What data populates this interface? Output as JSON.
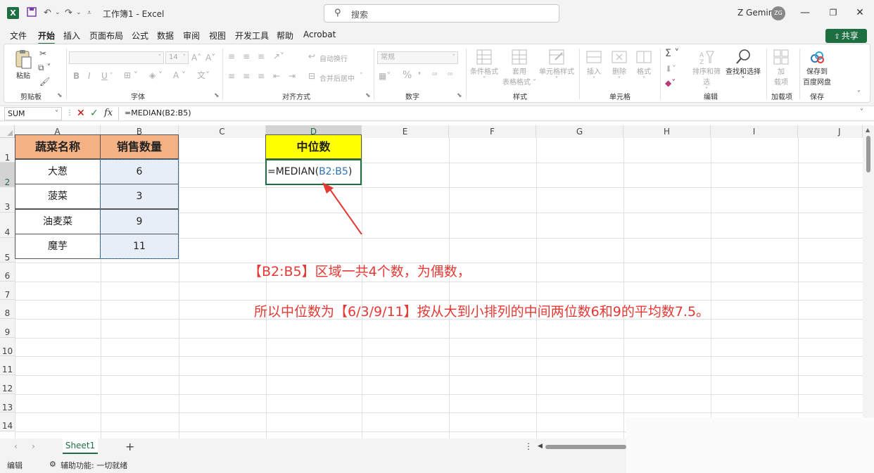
{
  "titlebar": {
    "logo": "X",
    "title": "工作簿1 - Excel",
    "search_placeholder": "搜索",
    "user": "Z Gemini",
    "avatar": "ZG"
  },
  "menu": {
    "tabs": [
      "文件",
      "开始",
      "插入",
      "页面布局",
      "公式",
      "数据",
      "审阅",
      "视图",
      "开发工具",
      "帮助",
      "Acrobat"
    ],
    "active": "开始",
    "share": "共享"
  },
  "ribbon": {
    "clipboard": {
      "paste": "粘贴",
      "label": "剪贴板"
    },
    "font": {
      "size": "14",
      "bold": "B",
      "italic": "I",
      "underline": "U",
      "label": "字体"
    },
    "alignment": {
      "wrap": "自动换行",
      "merge": "合并后居中",
      "label": "对齐方式"
    },
    "number": {
      "format": "常规",
      "label": "数字"
    },
    "styles": {
      "conditional_1": "条件格式",
      "table_1": "套用",
      "table_2": "表格格式",
      "cell_styles": "单元格样式",
      "label": "样式"
    },
    "cells": {
      "insert": "插入",
      "delete": "删除",
      "format": "格式",
      "label": "单元格"
    },
    "editing": {
      "sort": "排序和筛选",
      "find": "查找和选择",
      "label": "编辑"
    },
    "addins": {
      "btn_1": "加",
      "btn_2": "载项",
      "label": "加载项"
    },
    "save": {
      "btn_1": "保存到",
      "btn_2": "百度网盘",
      "label": "保存"
    }
  },
  "formula_bar": {
    "name_box": "SUM",
    "formula": "=MEDIAN(B2:B5)"
  },
  "grid": {
    "columns": [
      "A",
      "B",
      "C",
      "D",
      "E",
      "F",
      "G",
      "H",
      "I",
      "J"
    ],
    "rows": [
      "1",
      "2",
      "3",
      "4",
      "5",
      "6",
      "7",
      "8",
      "9",
      "10",
      "11",
      "12",
      "13",
      "14"
    ],
    "header_a": "蔬菜名称",
    "header_b": "销售数量",
    "table": [
      {
        "name": "大葱",
        "qty": "6"
      },
      {
        "name": "菠菜",
        "qty": "3"
      },
      {
        "name": "油麦菜",
        "qty": "9"
      },
      {
        "name": "魔芋",
        "qty": "11"
      }
    ],
    "d1": "中位数",
    "d2_prefix": "=MEDIAN(",
    "d2_ref": "B2:B5",
    "d2_suffix": ")"
  },
  "annotations": {
    "line1": "【B2:B5】区域一共4个数，为偶数，",
    "line2": "所以中位数为【6/3/9/11】按从大到小排列的中间两位数6和9的平均数7.5。"
  },
  "sheets": {
    "tab": "Sheet1"
  },
  "status": {
    "mode": "编辑",
    "accessibility": "辅助功能: 一切就绪"
  },
  "colors": {
    "excel_green": "#1d6f42",
    "header_orange": "#f4b183",
    "highlight_yellow": "#ffff00",
    "annotation_red": "#e53935",
    "range_blue": "#2f75b5"
  }
}
